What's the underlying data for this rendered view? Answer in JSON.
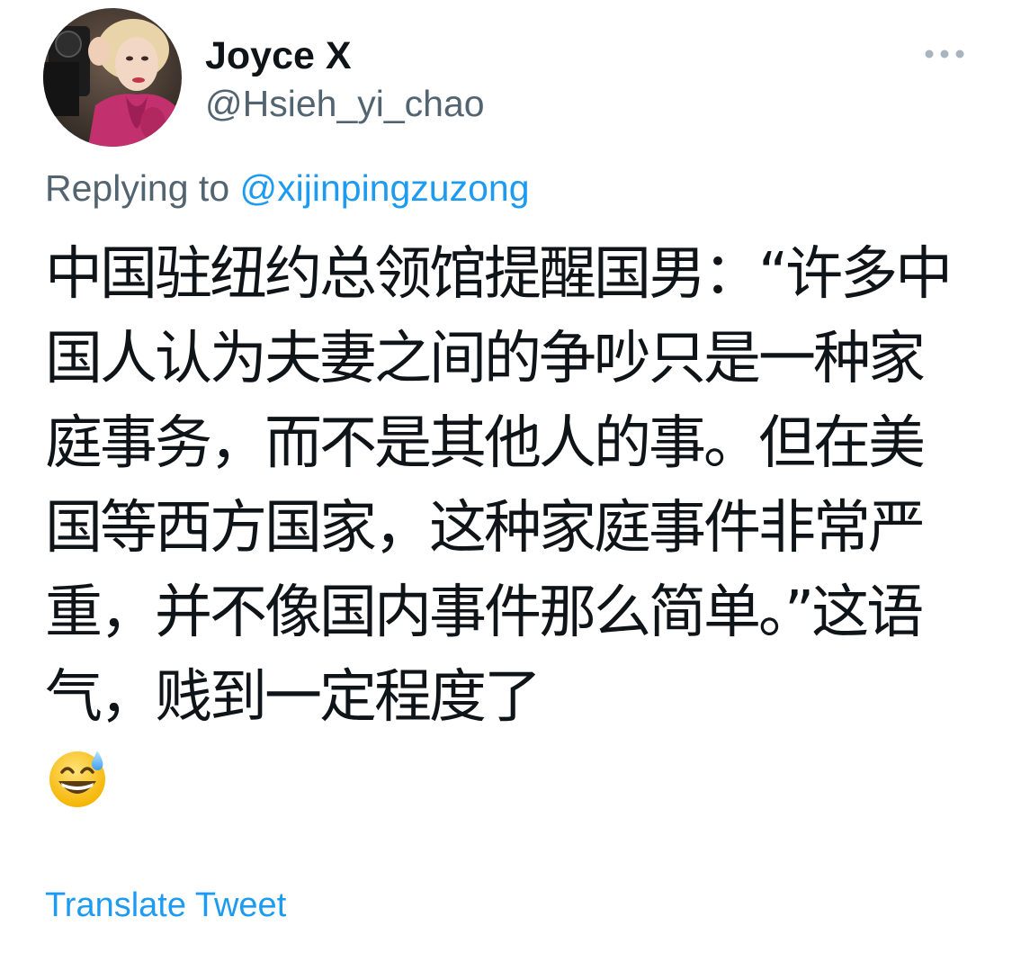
{
  "author": {
    "display_name": "Joyce X",
    "handle": "@Hsieh_yi_chao",
    "avatar_icon": "profile-photo-woman-with-camera"
  },
  "more_menu": {
    "icon": "ellipsis-icon"
  },
  "reply": {
    "prefix": "Replying to ",
    "mention": "@xijinpingzuzong"
  },
  "tweet": {
    "text": "中国驻纽约总领馆提醒国男：“许多中国人认为夫妻之间的争吵只是一种家庭事务，而不是其他人的事。但在美国等西方国家，这种家庭事件非常严重，并不像国内事件那么简单。”这语气，贱到一定程度了",
    "emoji": "grinning-face-with-sweat-emoji"
  },
  "translate_label": "Translate Tweet",
  "colors": {
    "accent": "#1d9bf0",
    "secondary_text": "#536471",
    "primary_text": "#0f1419",
    "more_dots": "#a9b4c0"
  }
}
